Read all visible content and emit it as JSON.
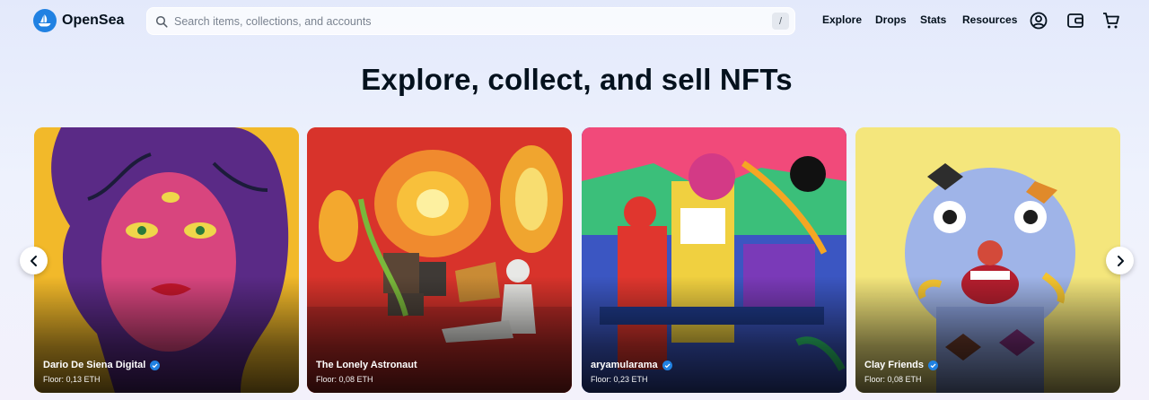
{
  "header": {
    "brand": "OpenSea",
    "search_placeholder": "Search items, collections, and accounts",
    "search_shortcut": "/",
    "nav": {
      "explore": "Explore",
      "drops": "Drops",
      "stats": "Stats",
      "resources": "Resources"
    },
    "icons": [
      "opensea-logo-icon",
      "search-icon",
      "profile-icon",
      "wallet-icon",
      "cart-icon"
    ]
  },
  "hero": {
    "title": "Explore, collect, and sell NFTs"
  },
  "carousel": {
    "cards": [
      {
        "name": "Dario De Siena Digital",
        "floor": "Floor: 0,13 ETH",
        "verified": true
      },
      {
        "name": "The Lonely Astronaut",
        "floor": "Floor: 0,08 ETH",
        "verified": false
      },
      {
        "name": "aryamularama",
        "floor": "Floor: 0,23 ETH",
        "verified": true
      },
      {
        "name": "Clay Friends",
        "floor": "Floor: 0,08 ETH",
        "verified": true
      }
    ],
    "prev_icon": "chevron-left-icon",
    "next_icon": "chevron-right-icon"
  },
  "colors": {
    "brand_blue": "#2081e2",
    "text_dark": "#04111d"
  }
}
